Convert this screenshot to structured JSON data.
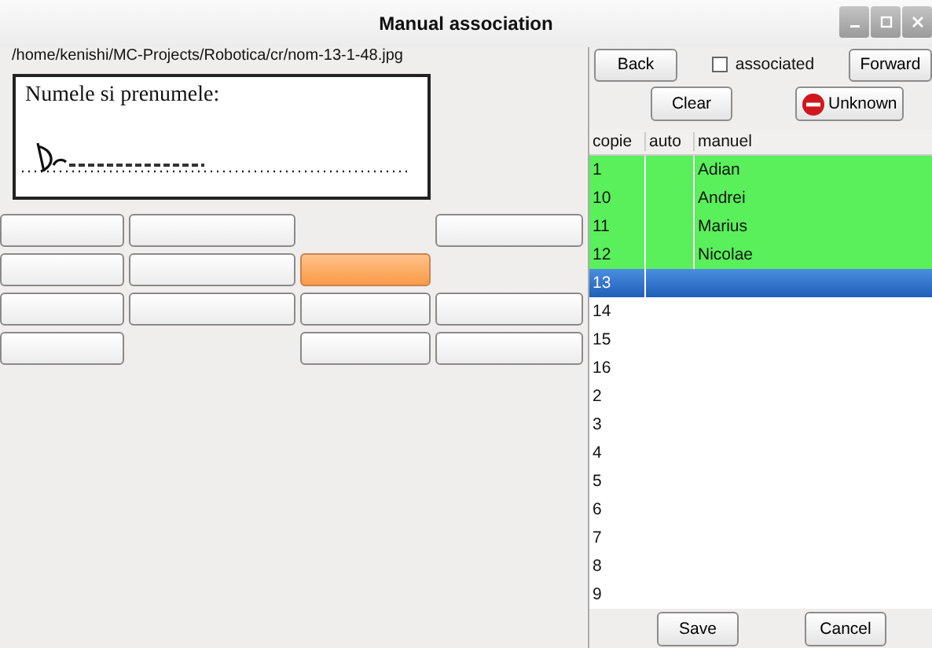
{
  "window": {
    "title": "Manual association"
  },
  "left": {
    "path": "/home/kenishi/MC-Projects/Robotica/cr/nom-13-1-48.jpg",
    "scan": {
      "label": "Numele si prenumele:"
    },
    "grid": [
      [
        {
          "kind": "button",
          "selected": false
        },
        {
          "kind": "button",
          "selected": false
        },
        {
          "kind": "empty"
        },
        {
          "kind": "button",
          "selected": false
        }
      ],
      [
        {
          "kind": "button",
          "selected": false
        },
        {
          "kind": "button",
          "selected": false
        },
        {
          "kind": "button",
          "selected": true
        },
        {
          "kind": "empty"
        }
      ],
      [
        {
          "kind": "button",
          "selected": false
        },
        {
          "kind": "button",
          "selected": false
        },
        {
          "kind": "button",
          "selected": false
        },
        {
          "kind": "button",
          "selected": false
        }
      ],
      [
        {
          "kind": "button",
          "selected": false
        },
        {
          "kind": "empty"
        },
        {
          "kind": "button",
          "selected": false
        },
        {
          "kind": "button",
          "selected": false
        }
      ]
    ]
  },
  "right": {
    "back": "Back",
    "associated": {
      "label": "associated",
      "checked": false
    },
    "forward": "Forward",
    "clear": "Clear",
    "unknown": "Unknown",
    "table": {
      "columns": [
        "copie",
        "auto",
        "manuel"
      ],
      "rows": [
        {
          "copie": "1",
          "manuel": "Adian",
          "associated": true,
          "selected": false
        },
        {
          "copie": "10",
          "manuel": "Andrei",
          "associated": true,
          "selected": false
        },
        {
          "copie": "11",
          "manuel": "Marius",
          "associated": true,
          "selected": false
        },
        {
          "copie": "12",
          "manuel": "Nicolae",
          "associated": true,
          "selected": false
        },
        {
          "copie": "13",
          "associated": false,
          "selected": true
        },
        {
          "copie": "14",
          "associated": false,
          "selected": false
        },
        {
          "copie": "15",
          "associated": false,
          "selected": false
        },
        {
          "copie": "16",
          "associated": false,
          "selected": false
        },
        {
          "copie": "2",
          "associated": false,
          "selected": false
        },
        {
          "copie": "3",
          "associated": false,
          "selected": false
        },
        {
          "copie": "4",
          "associated": false,
          "selected": false
        },
        {
          "copie": "5",
          "associated": false,
          "selected": false
        },
        {
          "copie": "6",
          "associated": false,
          "selected": false
        },
        {
          "copie": "7",
          "associated": false,
          "selected": false
        },
        {
          "copie": "8",
          "associated": false,
          "selected": false
        },
        {
          "copie": "9",
          "associated": false,
          "selected": false
        }
      ]
    },
    "save": "Save",
    "cancel": "Cancel"
  }
}
